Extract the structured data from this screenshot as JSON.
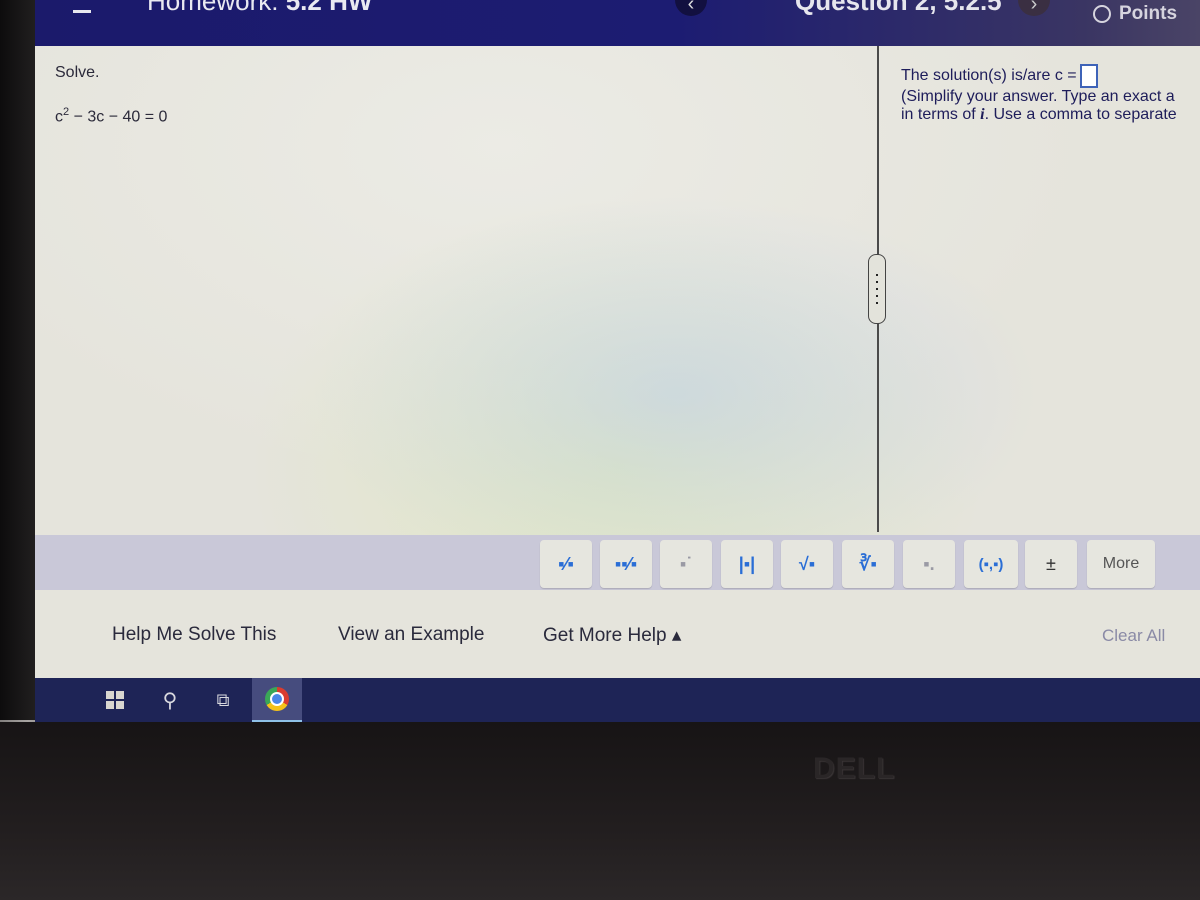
{
  "header": {
    "homework_label": "Homework:",
    "homework_name": "5.2 HW",
    "question_title": "Question 2, 5.2.5",
    "prev_icon": "chevron-left-icon",
    "next_icon": "chevron-right-icon",
    "points_label": "Points"
  },
  "problem": {
    "instruction": "Solve.",
    "equation_base": "c",
    "equation_exponent": "2",
    "equation_rest": " − 3c − 40 = 0"
  },
  "answer": {
    "prefix": "The solution(s) is/are c =",
    "value": "",
    "hint_line1": "(Simplify your answer. Type an exact a",
    "hint_line2_pre": "in terms of ",
    "hint_italic": "i",
    "hint_line2_post": ". Use a comma to separate"
  },
  "math_toolbar": {
    "buttons": [
      {
        "name": "fraction",
        "glyph": "▪⁄▪"
      },
      {
        "name": "mixed-number",
        "glyph": "▪▪⁄▪"
      },
      {
        "name": "exponent",
        "glyph": "▪˙"
      },
      {
        "name": "absolute-value",
        "glyph": "|▪|"
      },
      {
        "name": "square-root",
        "glyph": "√▪"
      },
      {
        "name": "nth-root",
        "glyph": "∛▪"
      },
      {
        "name": "subscript",
        "glyph": "▪."
      },
      {
        "name": "ordered-pair",
        "glyph": "(▪,▪)"
      },
      {
        "name": "plus-minus",
        "glyph": "±"
      }
    ],
    "more_label": "More"
  },
  "help": {
    "help_me_solve": "Help Me Solve This",
    "view_example": "View an Example",
    "get_more_help": "Get More Help ▴",
    "clear_all": "Clear All"
  },
  "taskbar": {
    "items": [
      "windows-start",
      "search",
      "task-view",
      "chrome"
    ]
  },
  "bezel": {
    "brand": "DELL"
  }
}
